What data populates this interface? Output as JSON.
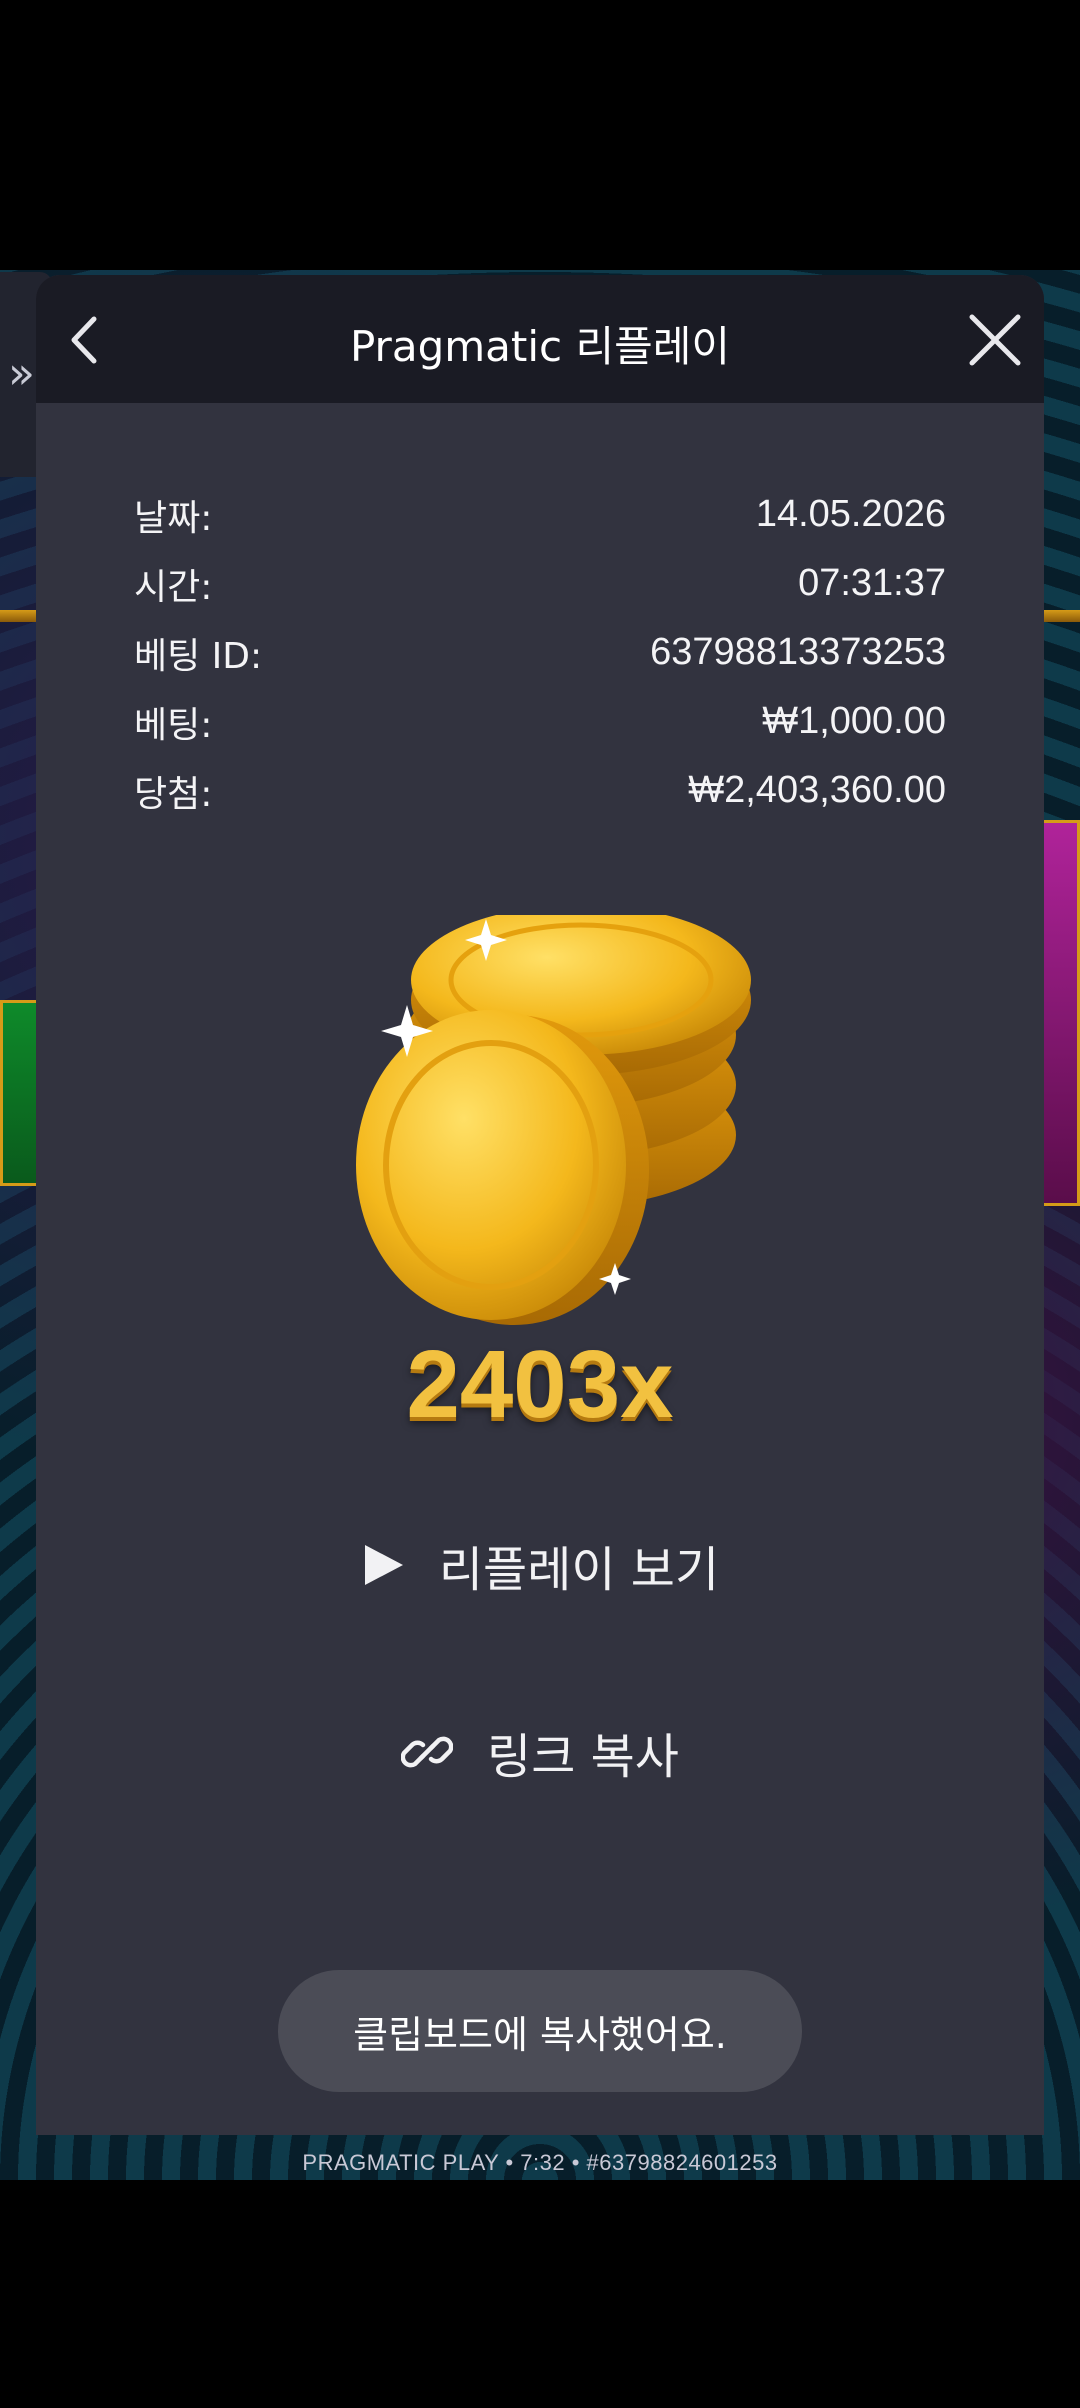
{
  "modal": {
    "title": "Pragmatic 리플레이",
    "rows": [
      {
        "label": "날짜:",
        "value": "14.05.2026"
      },
      {
        "label": "시간:",
        "value": "07:31:37"
      },
      {
        "label": "베팅 ID:",
        "value": "63798813373253"
      },
      {
        "label": "베팅:",
        "value": "₩1,000.00"
      },
      {
        "label": "당첨:",
        "value": "₩2,403,360.00"
      }
    ],
    "multiplier": "2403x",
    "replay_label": "리플레이 보기",
    "copy_link_label": "링크 복사"
  },
  "toast": "클립보드에 복사했어요.",
  "background": {
    "footer": "PRAGMATIC PLAY • 7:32 • #63798824601253"
  },
  "icons": {
    "side": "double-chevron-right-icon",
    "back": "chevron-left-icon",
    "close": "close-icon",
    "play": "play-icon",
    "link": "link-icon",
    "coins": "gold-coins-icon"
  },
  "colors": {
    "modal_bg": "#32333f",
    "header_bg": "#1a1b24",
    "multiplier": "#f2c140",
    "toast_bg": "#4b4c56"
  }
}
